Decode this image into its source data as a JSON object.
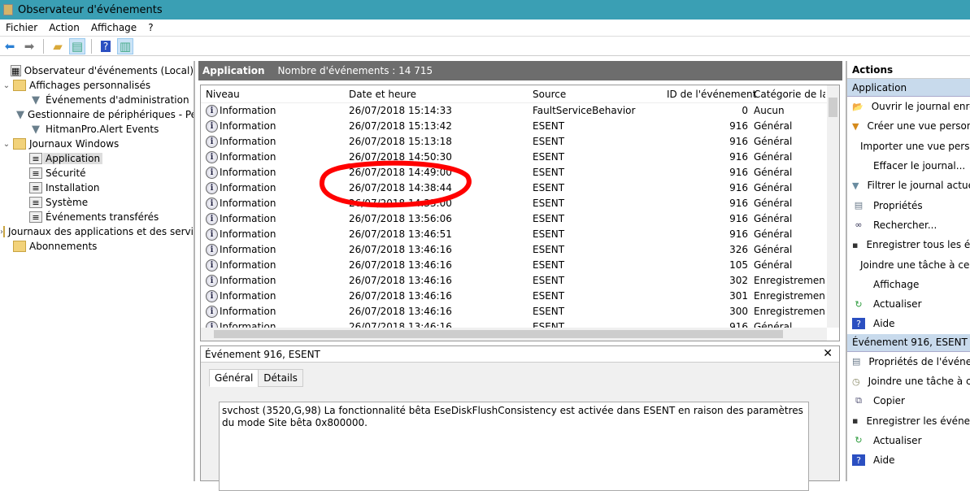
{
  "window": {
    "title": "Observateur d'événements"
  },
  "menu": [
    "Fichier",
    "Action",
    "Affichage",
    "?"
  ],
  "tree": [
    {
      "label": "Observateur d'événements (Local)",
      "level": 0,
      "icon": "event-viewer-icon",
      "chev": ""
    },
    {
      "label": "Affichages personnalisés",
      "level": 0,
      "icon": "folder-icon",
      "chev": "⌄"
    },
    {
      "label": "Événements d'administration",
      "level": 1,
      "icon": "filter-icon",
      "chev": ""
    },
    {
      "label": "Gestionnaire de périphériques - Pé",
      "level": 1,
      "icon": "filter-icon",
      "chev": ""
    },
    {
      "label": "HitmanPro.Alert Events",
      "level": 1,
      "icon": "filter-icon",
      "chev": ""
    },
    {
      "label": "Journaux Windows",
      "level": 0,
      "icon": "folder-icon",
      "chev": "⌄"
    },
    {
      "label": "Application",
      "level": 1,
      "icon": "log-icon",
      "chev": "",
      "selected": true
    },
    {
      "label": "Sécurité",
      "level": 1,
      "icon": "log-icon",
      "chev": ""
    },
    {
      "label": "Installation",
      "level": 1,
      "icon": "log-icon",
      "chev": ""
    },
    {
      "label": "Système",
      "level": 1,
      "icon": "log-icon",
      "chev": ""
    },
    {
      "label": "Événements transférés",
      "level": 1,
      "icon": "log-icon",
      "chev": ""
    },
    {
      "label": "Journaux des applications et des services",
      "level": 0,
      "icon": "folder-icon",
      "chev": "›"
    },
    {
      "label": "Abonnements",
      "level": 0,
      "icon": "folder-icon",
      "chev": ""
    }
  ],
  "center": {
    "title": "Application",
    "count": "Nombre d'événements : 14 715"
  },
  "columns": [
    "Niveau",
    "Date et heure",
    "Source",
    "ID de l'événement",
    "Catégorie de la tâche"
  ],
  "rows": [
    [
      "Information",
      "26/07/2018 15:14:33",
      "FaultServiceBehavior",
      "0",
      "Aucun"
    ],
    [
      "Information",
      "26/07/2018 15:13:42",
      "ESENT",
      "916",
      "Général"
    ],
    [
      "Information",
      "26/07/2018 15:13:18",
      "ESENT",
      "916",
      "Général"
    ],
    [
      "Information",
      "26/07/2018 14:50:30",
      "ESENT",
      "916",
      "Général"
    ],
    [
      "Information",
      "26/07/2018 14:49:00",
      "ESENT",
      "916",
      "Général"
    ],
    [
      "Information",
      "26/07/2018 14:38:44",
      "ESENT",
      "916",
      "Général"
    ],
    [
      "Information",
      "26/07/2018 14:33:00",
      "ESENT",
      "916",
      "Général"
    ],
    [
      "Information",
      "26/07/2018 13:56:06",
      "ESENT",
      "916",
      "Général"
    ],
    [
      "Information",
      "26/07/2018 13:46:51",
      "ESENT",
      "916",
      "Général"
    ],
    [
      "Information",
      "26/07/2018 13:46:16",
      "ESENT",
      "326",
      "Général"
    ],
    [
      "Information",
      "26/07/2018 13:46:16",
      "ESENT",
      "105",
      "Général"
    ],
    [
      "Information",
      "26/07/2018 13:46:16",
      "ESENT",
      "302",
      "Enregistrement/récupération"
    ],
    [
      "Information",
      "26/07/2018 13:46:16",
      "ESENT",
      "301",
      "Enregistrement/récupération"
    ],
    [
      "Information",
      "26/07/2018 13:46:16",
      "ESENT",
      "300",
      "Enregistrement/récupération"
    ],
    [
      "Information",
      "26/07/2018 13:46:16",
      "ESENT",
      "916",
      "Général"
    ]
  ],
  "detail": {
    "title": "Événement 916, ESENT",
    "tabs": [
      "Général",
      "Détails"
    ],
    "message": "svchost (3520,G,98) La fonctionnalité bêta EseDiskFlushConsistency est activée dans ESENT en raison des paramètres du mode Site bêta 0x800000."
  },
  "actions": {
    "header": "Actions",
    "sections": [
      {
        "title": "Application",
        "items": [
          {
            "label": "Ouvrir le journal enregistré...",
            "icon": "open-folder-icon"
          },
          {
            "label": "Créer une vue personnalisée...",
            "icon": "create-filter-icon"
          },
          {
            "label": "Importer une vue personnalisée...",
            "icon": ""
          },
          {
            "label": "Effacer le journal...",
            "icon": ""
          },
          {
            "label": "Filtrer le journal actuel...",
            "icon": "filter-icon"
          },
          {
            "label": "Propriétés",
            "icon": "properties-icon"
          },
          {
            "label": "Rechercher...",
            "icon": "binoculars-icon"
          },
          {
            "label": "Enregistrer tous les événements sous...",
            "icon": "save-icon"
          },
          {
            "label": "Joindre une tâche à ce journal...",
            "icon": ""
          },
          {
            "label": "Affichage",
            "icon": ""
          },
          {
            "label": "Actualiser",
            "icon": "refresh-icon"
          },
          {
            "label": "Aide",
            "icon": "help-icon"
          }
        ]
      },
      {
        "title": "Événement 916, ESENT",
        "items": [
          {
            "label": "Propriétés de l'événement",
            "icon": "properties-icon"
          },
          {
            "label": "Joindre une tâche à cet événement...",
            "icon": "task-icon"
          },
          {
            "label": "Copier",
            "icon": "copy-icon"
          },
          {
            "label": "Enregistrer les événements sélectionnés...",
            "icon": "save-icon"
          },
          {
            "label": "Actualiser",
            "icon": "refresh-icon"
          },
          {
            "label": "Aide",
            "icon": "help-icon"
          }
        ]
      }
    ]
  },
  "annotation_color": "#ff0000"
}
